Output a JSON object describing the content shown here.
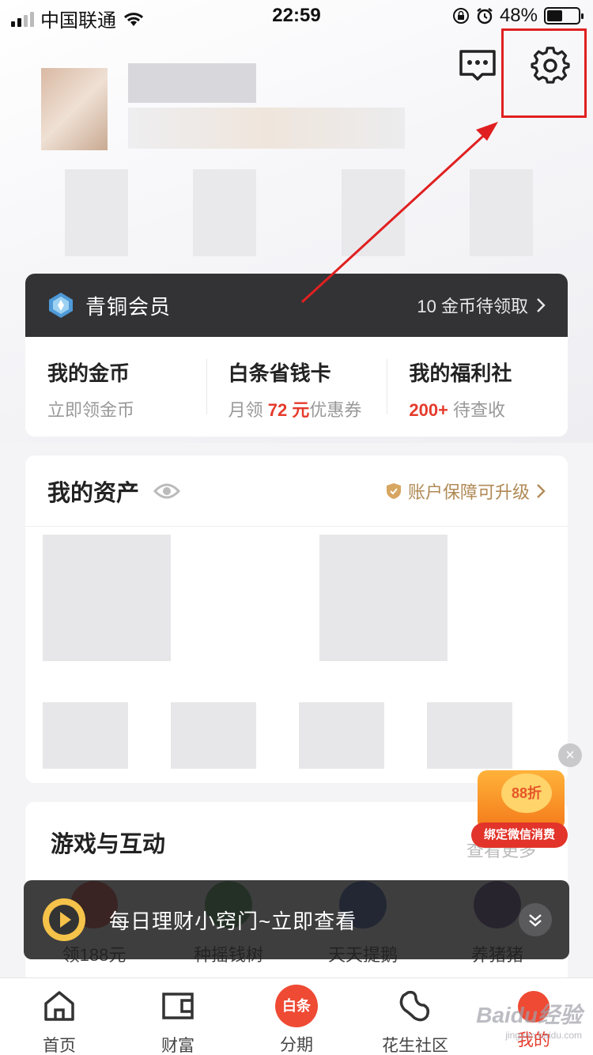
{
  "status_bar": {
    "carrier": "中国联通",
    "time": "22:59",
    "battery": "48%"
  },
  "member": {
    "level": "青铜会员",
    "claim": "10 金币待领取",
    "cells": [
      {
        "title": "我的金币",
        "sub": "立即领金币"
      },
      {
        "title": "白条省钱卡",
        "sub_pre": "月领 ",
        "sub_em": "72 元",
        "sub_post": "优惠券"
      },
      {
        "title": "我的福利社",
        "sub_em": "200+",
        "sub_post": " 待查收"
      }
    ]
  },
  "assets": {
    "title": "我的资产",
    "secure": "账户保障可升级"
  },
  "games": {
    "title": "游戏与互动",
    "more": "查看更多",
    "items": [
      {
        "label": "领188元",
        "color": "#d84a3a"
      },
      {
        "label": "种摇钱树",
        "color": "#4a9a4a"
      },
      {
        "label": "天天提鹅",
        "color": "#3a5aa8"
      },
      {
        "label": "养猪猪",
        "color": "#5a4a8a"
      }
    ]
  },
  "promo": {
    "discount": "88折",
    "band": "绑定微信消费",
    "close": "×"
  },
  "toast": {
    "text": "每日理财小窍门~立即查看"
  },
  "tabs": [
    {
      "label": "首页"
    },
    {
      "label": "财富"
    },
    {
      "label": "分期",
      "badge": "白条"
    },
    {
      "label": "花生社区"
    },
    {
      "label": "我的"
    }
  ],
  "watermark": {
    "main": "Baidu经验",
    "sub": "jingyan.baidu.com"
  },
  "colors": {
    "accent": "#e53b2c",
    "highlight_box": "#e02020",
    "gold": "#b08a55"
  }
}
